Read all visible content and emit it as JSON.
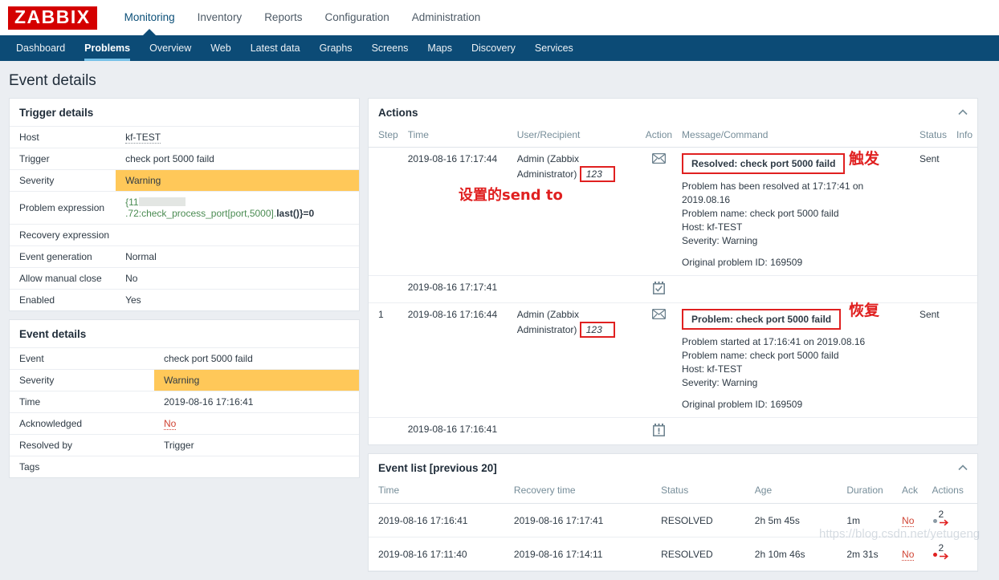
{
  "app": {
    "logo": "ZABBIX",
    "main_nav": [
      {
        "label": "Monitoring",
        "selected": true
      },
      {
        "label": "Inventory",
        "selected": false
      },
      {
        "label": "Reports",
        "selected": false
      },
      {
        "label": "Configuration",
        "selected": false
      },
      {
        "label": "Administration",
        "selected": false
      }
    ],
    "sub_nav": [
      {
        "label": "Dashboard",
        "selected": false
      },
      {
        "label": "Problems",
        "selected": true
      },
      {
        "label": "Overview",
        "selected": false
      },
      {
        "label": "Web",
        "selected": false
      },
      {
        "label": "Latest data",
        "selected": false
      },
      {
        "label": "Graphs",
        "selected": false
      },
      {
        "label": "Screens",
        "selected": false
      },
      {
        "label": "Maps",
        "selected": false
      },
      {
        "label": "Discovery",
        "selected": false
      },
      {
        "label": "Services",
        "selected": false
      }
    ],
    "page_title": "Event details"
  },
  "trigger_details": {
    "title": "Trigger details",
    "rows": {
      "host_label": "Host",
      "host_value": "kf-TEST",
      "trigger_label": "Trigger",
      "trigger_value": "check port 5000 faild",
      "severity_label": "Severity",
      "severity_value": "Warning",
      "problem_expression_label": "Problem expression",
      "problem_expression_prefix": "{11",
      "problem_expression_suffix": ".72:check_process_port[port,5000].",
      "problem_expression_func": "last()",
      "problem_expression_tail": "}=0",
      "recovery_expression_label": "Recovery expression",
      "recovery_expression_value": "",
      "event_generation_label": "Event generation",
      "event_generation_value": "Normal",
      "allow_manual_close_label": "Allow manual close",
      "allow_manual_close_value": "No",
      "enabled_label": "Enabled",
      "enabled_value": "Yes"
    }
  },
  "event_details": {
    "title": "Event details",
    "rows": {
      "event_label": "Event",
      "event_value": "check port 5000 faild",
      "severity_label": "Severity",
      "severity_value": "Warning",
      "time_label": "Time",
      "time_value": "2019-08-16 17:16:41",
      "acknowledged_label": "Acknowledged",
      "acknowledged_value": "No",
      "resolved_by_label": "Resolved by",
      "resolved_by_value": "Trigger",
      "tags_label": "Tags",
      "tags_value": ""
    }
  },
  "actions": {
    "title": "Actions",
    "columns": {
      "step": "Step",
      "time": "Time",
      "user": "User/Recipient",
      "action": "Action",
      "message": "Message/Command",
      "status": "Status",
      "info": "Info"
    },
    "rows": [
      {
        "step": "",
        "time": "2019-08-16 17:17:44",
        "user": "Admin (Zabbix Administrator)",
        "user_sendto": "123",
        "action_icon": "envelope-icon",
        "subject": "Resolved: check port 5000 faild",
        "body": [
          "Problem has been resolved at 17:17:41 on 2019.08.16",
          "Problem name: check port 5000 faild",
          "Host: kf-TEST",
          "Severity: Warning",
          "",
          "Original problem ID: 169509"
        ],
        "status": "Sent",
        "info": ""
      },
      {
        "step": "",
        "time": "2019-08-16 17:17:41",
        "user": "",
        "user_sendto": "",
        "action_icon": "calendar-check-icon",
        "subject": "",
        "body": [],
        "status": "",
        "info": ""
      },
      {
        "step": "1",
        "time": "2019-08-16 17:16:44",
        "user": "Admin (Zabbix Administrator)",
        "user_sendto": "123",
        "action_icon": "envelope-icon",
        "subject": "Problem: check port 5000 faild",
        "body": [
          "Problem started at 17:16:41 on 2019.08.16",
          "Problem name: check port 5000 faild",
          "Host: kf-TEST",
          "Severity: Warning",
          "",
          "Original problem ID: 169509"
        ],
        "status": "Sent",
        "info": ""
      },
      {
        "step": "",
        "time": "2019-08-16 17:16:41",
        "user": "",
        "user_sendto": "",
        "action_icon": "calendar-alert-icon",
        "subject": "",
        "body": [],
        "status": "",
        "info": ""
      }
    ]
  },
  "event_list": {
    "title": "Event list [previous 20]",
    "columns": {
      "time": "Time",
      "recovery_time": "Recovery time",
      "status": "Status",
      "age": "Age",
      "duration": "Duration",
      "ack": "Ack",
      "actions": "Actions"
    },
    "rows": [
      {
        "time": "2019-08-16 17:16:41",
        "recovery_time": "2019-08-16 17:17:41",
        "status": "RESOLVED",
        "age": "2h 5m 45s",
        "duration": "1m",
        "ack": "No",
        "actions_count": "2",
        "actions_dot_color": "#8b9aa5"
      },
      {
        "time": "2019-08-16 17:11:40",
        "recovery_time": "2019-08-16 17:14:11",
        "status": "RESOLVED",
        "age": "2h 10m 46s",
        "duration": "2m 31s",
        "ack": "No",
        "actions_count": "2",
        "actions_dot_color": "#e02020"
      }
    ]
  },
  "annotations": {
    "trigger_note": "触发",
    "recover_note": "恢复",
    "sendto_note": "设置的send to",
    "color": "#e02020"
  },
  "watermark": {
    "text": "https://blog.csdn.net/yetugeng"
  }
}
